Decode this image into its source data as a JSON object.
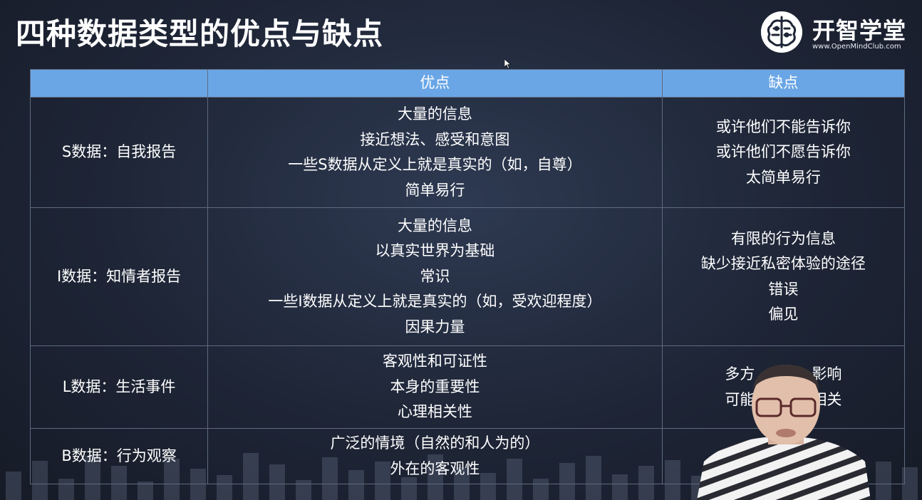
{
  "slide": {
    "title": "四种数据类型的优点与缺点"
  },
  "brand": {
    "name": "开智学堂",
    "url": "www.OpenMindClub.com",
    "accent": "#6aa6e6"
  },
  "table": {
    "headers": [
      "",
      "优点",
      "缺点"
    ],
    "rows": [
      {
        "label": "S数据：自我报告",
        "pros": [
          "大量的信息",
          "接近想法、感受和意图",
          "一些S数据从定义上就是真实的（如，自尊）",
          "简单易行"
        ],
        "cons": [
          "或许他们不能告诉你",
          "或许他们不愿告诉你",
          "太简单易行"
        ]
      },
      {
        "label": "I数据：知情者报告",
        "pros": [
          "大量的信息",
          "以真实世界为基础",
          "常识",
          "一些I数据从定义上就是真实的（如，受欢迎程度）",
          "因果力量"
        ],
        "cons": [
          "有限的行为信息",
          "缺少接近私密体验的途径",
          "错误",
          "偏见"
        ]
      },
      {
        "label": "L数据：生活事件",
        "pros": [
          "客观性和可证性",
          "本身的重要性",
          "心理相关性"
        ],
        "cons": [
          "多方",
          "影响",
          "可能",
          "相关"
        ]
      },
      {
        "label": "B数据：行为观察",
        "pros": [
          "广泛的情境（自然的和人为的）",
          "外在的客观性"
        ],
        "cons": []
      }
    ]
  }
}
